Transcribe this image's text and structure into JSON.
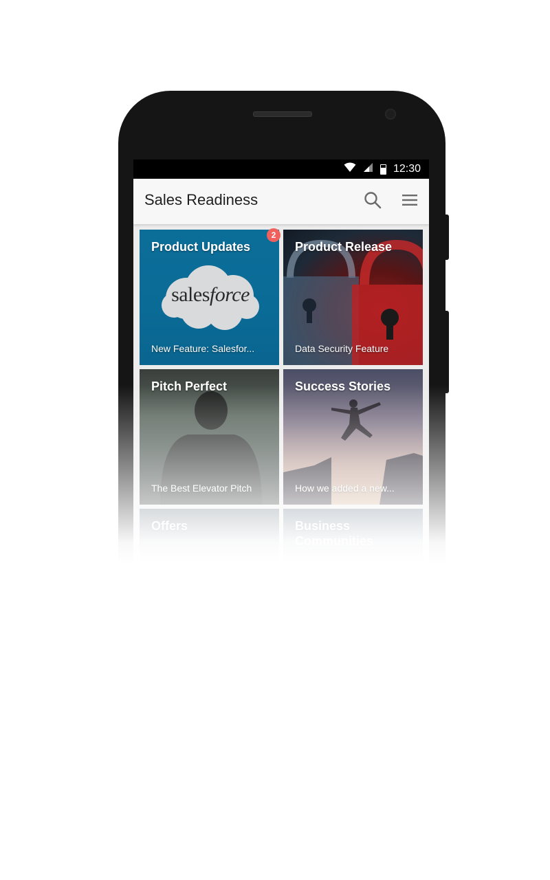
{
  "status_bar": {
    "time": "12:30",
    "icons": [
      "wifi-icon",
      "signal-icon",
      "battery-icon"
    ]
  },
  "app_bar": {
    "title": "Sales Readiness",
    "actions": [
      "search-icon",
      "menu-icon"
    ]
  },
  "tiles": [
    {
      "title": "Product Updates",
      "subtitle": "New Feature: Salesfor...",
      "badge": "2",
      "logo_text_1": "sales",
      "logo_text_2": "force"
    },
    {
      "title": "Product Release",
      "subtitle": "Data Security Feature"
    },
    {
      "title": "Pitch Perfect",
      "subtitle": "The Best Elevator Pitch"
    },
    {
      "title": "Success Stories",
      "subtitle": "How we added a new..."
    },
    {
      "title": "Offers",
      "subtitle": ""
    },
    {
      "title": "Business Communities",
      "subtitle": ""
    }
  ],
  "colors": {
    "badge": "#f0605c",
    "app_bar": "#f7f7f7",
    "product_updates_bg": "#0b6e99"
  }
}
